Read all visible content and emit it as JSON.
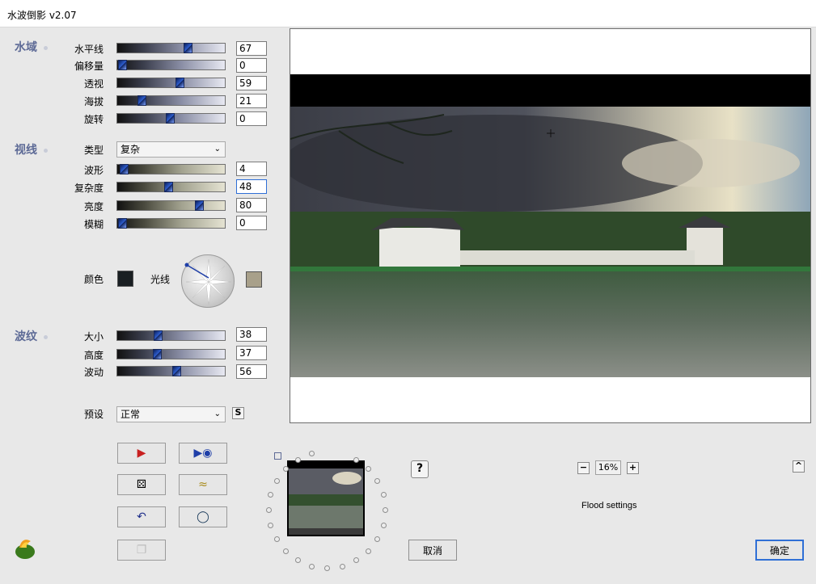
{
  "window": {
    "title": "水波倒影 v2.07"
  },
  "sections": {
    "water": "水域",
    "sight": "视线",
    "ripple": "波纹"
  },
  "water": {
    "horizon": {
      "label": "水平线",
      "value": "67"
    },
    "offset": {
      "label": "偏移量",
      "value": "0"
    },
    "perspective": {
      "label": "透视",
      "value": "59"
    },
    "altitude": {
      "label": "海拔",
      "value": "21"
    },
    "rotation": {
      "label": "旋转",
      "value": "0"
    }
  },
  "sight": {
    "type": {
      "label": "类型",
      "value": "复杂"
    },
    "waveform": {
      "label": "波形",
      "value": "4"
    },
    "complexity": {
      "label": "复杂度",
      "value": "48"
    },
    "brightness": {
      "label": "亮度",
      "value": "80"
    },
    "blur": {
      "label": "模糊",
      "value": "0"
    },
    "color_label": "颜色",
    "light_label": "光线"
  },
  "ripple": {
    "size": {
      "label": "大小",
      "value": "38"
    },
    "height": {
      "label": "高度",
      "value": "37"
    },
    "motion": {
      "label": "波动",
      "value": "56"
    }
  },
  "preset": {
    "label": "预设",
    "value": "正常",
    "save_label": "S"
  },
  "zoom": {
    "minus": "−",
    "value": "16%",
    "plus": "+"
  },
  "help_label": "?",
  "collapse_label": "^",
  "flood_settings": "Flood settings",
  "buttons": {
    "cancel": "取消",
    "ok": "确定"
  },
  "colors": {
    "accent": "#5d6a96",
    "color_swatch": "#1a1f22",
    "light_swatch": "#a8a08a"
  }
}
